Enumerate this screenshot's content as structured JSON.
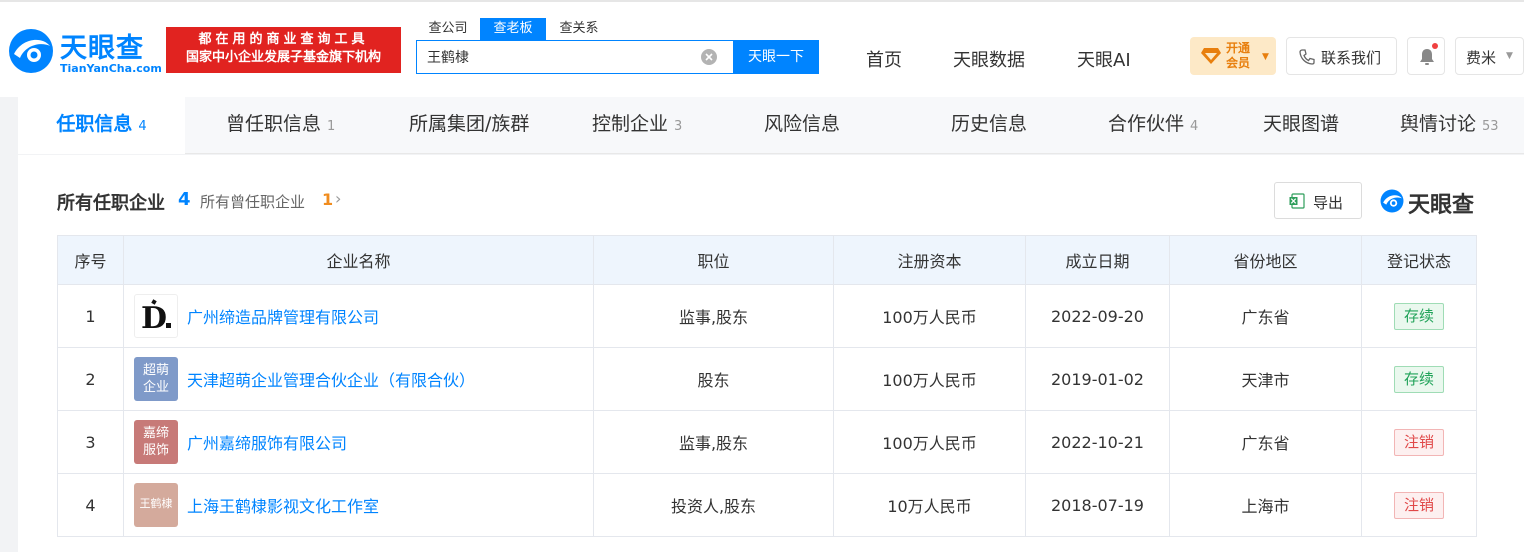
{
  "header": {
    "logo_cn": "天眼查",
    "logo_en": "TianYanCha.com",
    "slogan_line1": "都在用的商业查询工具",
    "slogan_line2": "国家中小企业发展子基金旗下机构",
    "search_tabs": [
      "查公司",
      "查老板",
      "查关系"
    ],
    "active_search_tab": "查老板",
    "search_value": "王鹤棣",
    "search_button": "天眼一下",
    "nav": [
      "首页",
      "天眼数据",
      "天眼AI"
    ],
    "vip_line1": "开通",
    "vip_line2": "会员",
    "contact": "联系我们",
    "user": "费米"
  },
  "tabs": [
    {
      "label": "任职信息",
      "count": "4",
      "active": true
    },
    {
      "label": "曾任职信息",
      "count": "1"
    },
    {
      "label": "所属集团/族群",
      "count": ""
    },
    {
      "label": "控制企业",
      "count": "3"
    },
    {
      "label": "风险信息",
      "count": ""
    },
    {
      "label": "历史信息",
      "count": ""
    },
    {
      "label": "合作伙伴",
      "count": "4"
    },
    {
      "label": "天眼图谱",
      "count": ""
    },
    {
      "label": "舆情讨论",
      "count": "53"
    }
  ],
  "section": {
    "title": "所有任职企业",
    "count": "4",
    "sub_label": "所有曾任职企业",
    "sub_count": "1",
    "export_label": "导出",
    "brand": "天眼查"
  },
  "table": {
    "headers": [
      "序号",
      "企业名称",
      "职位",
      "注册资本",
      "成立日期",
      "省份地区",
      "登记状态"
    ],
    "rows": [
      {
        "index": "1",
        "logo_text": "D.",
        "logo_color": "#ffffff",
        "name": "广州缔造品牌管理有限公司",
        "position": "监事,股东",
        "capital": "100万人民币",
        "date": "2022-09-20",
        "region": "广东省",
        "status": "存续",
        "status_type": "ok"
      },
      {
        "index": "2",
        "logo_text": "超萌企业",
        "logo_color": "#7f9ac9",
        "name": "天津超萌企业管理合伙企业（有限合伙）",
        "position": "股东",
        "capital": "100万人民币",
        "date": "2019-01-02",
        "region": "天津市",
        "status": "存续",
        "status_type": "ok"
      },
      {
        "index": "3",
        "logo_text": "嘉缔服饰",
        "logo_color": "#c77a78",
        "name": "广州嘉缔服饰有限公司",
        "position": "监事,股东",
        "capital": "100万人民币",
        "date": "2022-10-21",
        "region": "广东省",
        "status": "注销",
        "status_type": "bad"
      },
      {
        "index": "4",
        "logo_text": "王鹤棣",
        "logo_color": "#d4aa9c",
        "name": "上海王鹤棣影视文化工作室",
        "position": "投资人,股东",
        "capital": "10万人民币",
        "date": "2018-07-19",
        "region": "上海市",
        "status": "注销",
        "status_type": "bad"
      }
    ]
  },
  "icons": {
    "brand_blue": "#0084ff",
    "export": "excel-icon",
    "contact": "phone-icon",
    "bell": "bell-icon",
    "vip": "diamond-icon"
  }
}
